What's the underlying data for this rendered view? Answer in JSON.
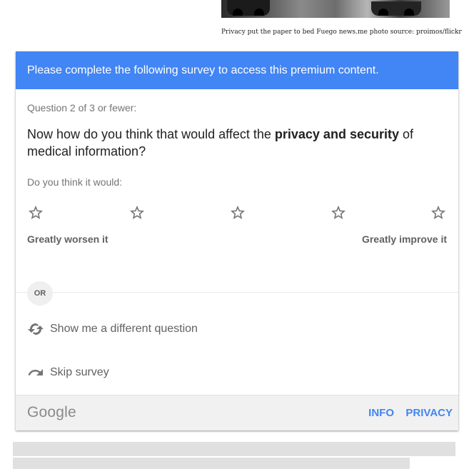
{
  "photo": {
    "caption": "Privacy put the paper to bed Fuego news.me photo source: proimos/flickr"
  },
  "survey": {
    "banner": "Please complete the following survey to access this premium content.",
    "question_count": "Question 2 of 3 or fewer:",
    "question_prefix": "Now how do you think that would affect the ",
    "question_bold": "privacy and security",
    "question_suffix": " of medical information?",
    "prompt": "Do you think it would:",
    "rating": {
      "stars": 5,
      "selected": 0,
      "left_label": "Greatly worsen it",
      "right_label": "Greatly improve it"
    },
    "or_label": "OR",
    "alt_options": [
      {
        "label": "Show me a different question",
        "icon": "refresh-icon"
      },
      {
        "label": "Skip survey",
        "icon": "skip-arrow-icon"
      }
    ]
  },
  "footer": {
    "logo": "Google",
    "info_label": "INFO",
    "privacy_label": "PRIVACY"
  },
  "colors": {
    "accent": "#4285f4",
    "star_outline": "#757575"
  }
}
